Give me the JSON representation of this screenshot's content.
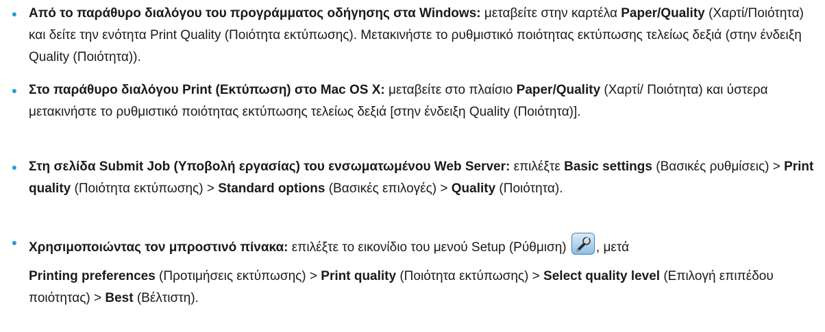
{
  "items": [
    {
      "runs": [
        {
          "t": "Από το παράθυρο διαλόγου του προγράμματος οδήγησης στα Windows:",
          "b": true
        },
        {
          "t": " μεταβείτε στην καρτέλα ",
          "b": false
        },
        {
          "t": "Paper/Quality",
          "b": true
        },
        {
          "t": " (Χαρτί/Ποιότητα) και δείτε την ενότητα Print Quality (Ποιότητα εκτύπωσης). Μετακινήστε το ρυθμιστικό ποιότητας εκτύπωσης τελείως δεξιά (στην ένδειξη Quality (Ποιότητα)).",
          "b": false
        }
      ]
    },
    {
      "runs": [
        {
          "t": "Στο παράθυρο διαλόγου Print (Εκτύπωση) στο Mac OS X:",
          "b": true
        },
        {
          "t": " μεταβείτε στο πλαίσιο ",
          "b": false
        },
        {
          "t": "Paper/Quality",
          "b": true
        },
        {
          "t": " (Χαρτί/ Ποιότητα) και ύστερα μετακινήστε το ρυθμιστικό ποιότητας εκτύπωσης τελείως δεξιά [στην ένδειξη Quality (Ποιότητα)].",
          "b": false
        }
      ]
    },
    {
      "runs": [
        {
          "t": "Στη σελίδα Submit Job (Υποβολή εργασίας) του ενσωματωμένου Web Server:",
          "b": true
        },
        {
          "t": " επιλέξτε ",
          "b": false
        },
        {
          "t": "Basic settings",
          "b": true
        },
        {
          "t": " (Βασικές ρυθμίσεις) > ",
          "b": false
        },
        {
          "t": "Print quality",
          "b": true
        },
        {
          "t": " (Ποιότητα εκτύπωσης) > ",
          "b": false
        },
        {
          "t": "Standard options",
          "b": true
        },
        {
          "t": " (Βασικές επιλογές) > ",
          "b": false
        },
        {
          "t": "Quality",
          "b": true
        },
        {
          "t": " (Ποιότητα).",
          "b": false
        }
      ]
    },
    {
      "first_runs": [
        {
          "t": "Χρησιμοποιώντας τον μπροστινό πίνακα:",
          "b": true
        },
        {
          "t": " επιλέξτε το εικονίδιο του μενού Setup (Ρύθμιση) ",
          "b": false
        }
      ],
      "icon": "wrench-setup-icon",
      "after_icon": ", μετά",
      "second_runs": [
        {
          "t": "Printing preferences",
          "b": true
        },
        {
          "t": " (Προτιμήσεις εκτύπωσης) > ",
          "b": false
        },
        {
          "t": "Print quality",
          "b": true
        },
        {
          "t": " (Ποιότητα εκτύπωσης) > ",
          "b": false
        },
        {
          "t": "Select quality level",
          "b": true
        },
        {
          "t": " (Επιλογή επιπέδου ποιότητας) > ",
          "b": false
        },
        {
          "t": "Best",
          "b": true
        },
        {
          "t": " (Βέλτιστη).",
          "b": false
        }
      ]
    }
  ],
  "colors": {
    "bullet": "#1f9cd8",
    "text": "#1a1a1a"
  }
}
